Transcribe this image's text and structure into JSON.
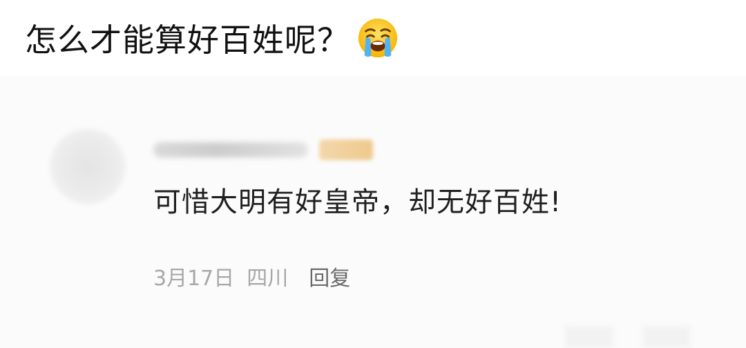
{
  "caption": {
    "text": "怎么才能算好百姓呢？",
    "emoji_icon": "loudly-crying-face-emoji"
  },
  "comment": {
    "avatar": "blurred-avatar",
    "username": "",
    "level_badge": "",
    "text": "可惜大明有好皇帝，却无好百姓!",
    "date": "3月17日",
    "location": "四川",
    "reply_label": "回复"
  },
  "colors": {
    "caption_text": "#111111",
    "comment_text": "#1f1f1f",
    "meta_text": "#a7a7a7",
    "reply_text": "#6a6a6a",
    "badge": "#efc98d",
    "background": "#ffffff",
    "card_background": "#fbfbfb"
  }
}
